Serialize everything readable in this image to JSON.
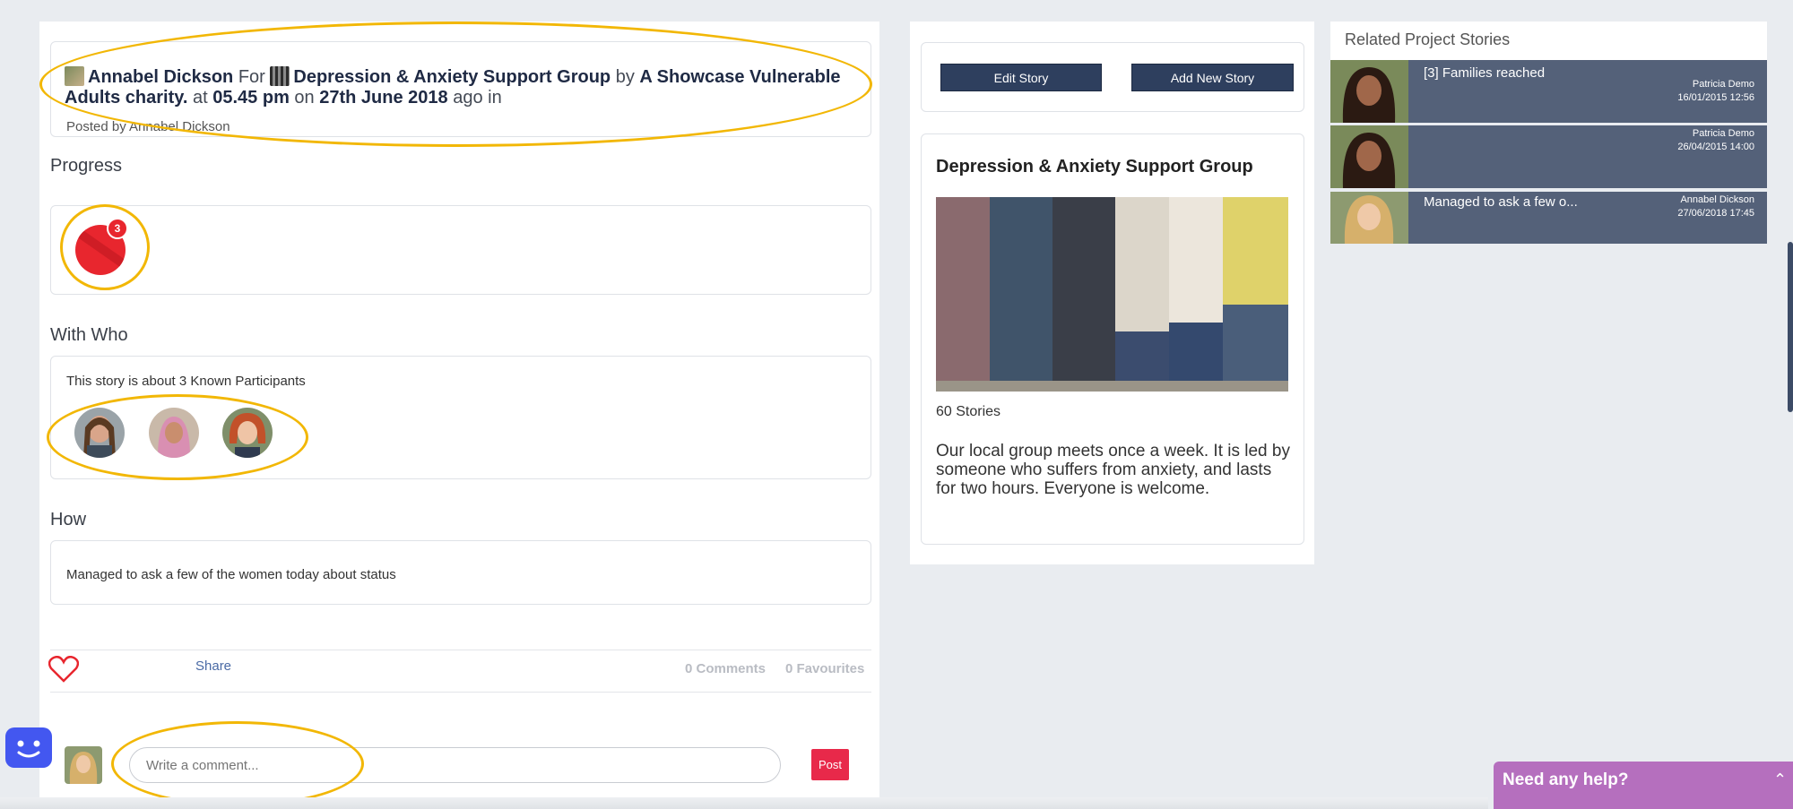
{
  "header": {
    "author": "Annabel Dickson",
    "for_word": "For",
    "group": "Depression & Anxiety Support Group",
    "by_word": "by",
    "charity": "A Showcase Vulnerable Adults charity.",
    "at_word": "at",
    "time": "05.45 pm",
    "on_word": "on",
    "date": "27th June 2018",
    "ago_in": "ago in",
    "posted_by": "Posted by Annabel Dickson"
  },
  "progress": {
    "label": "Progress",
    "badge_count": "3"
  },
  "with_who": {
    "label": "With Who",
    "summary": "This story is about 3 Known Participants"
  },
  "how": {
    "label": "How",
    "text": "Managed to ask a few of the women today about status"
  },
  "actions": {
    "share": "Share",
    "comments": "0 Comments",
    "favourites": "0 Favourites"
  },
  "comment": {
    "placeholder": "Write a comment...",
    "post": "Post"
  },
  "story_buttons": {
    "edit": "Edit Story",
    "add": "Add New Story"
  },
  "group_card": {
    "title": "Depression & Anxiety Support Group",
    "stories_count": "60 Stories",
    "description": "Our local group meets once a week. It is led by someone who suffers from anxiety, and lasts for two hours. Everyone is welcome."
  },
  "related": {
    "title": "Related Project Stories",
    "items": [
      {
        "title": "[3] Families reached",
        "author": "Patricia Demo",
        "date": "16/01/2015 12:56"
      },
      {
        "title": "",
        "author": "Patricia Demo",
        "date": "26/04/2015 14:00"
      },
      {
        "title": "Managed to ask a few o...",
        "author": "Annabel Dickson",
        "date": "27/06/2018 17:45"
      }
    ]
  },
  "help": {
    "label": "Need any help?"
  },
  "colors": {
    "accent": "#2e3f5e",
    "annotation": "#f2b705",
    "post_button": "#e8294a",
    "help_bar": "#b56fbe"
  }
}
